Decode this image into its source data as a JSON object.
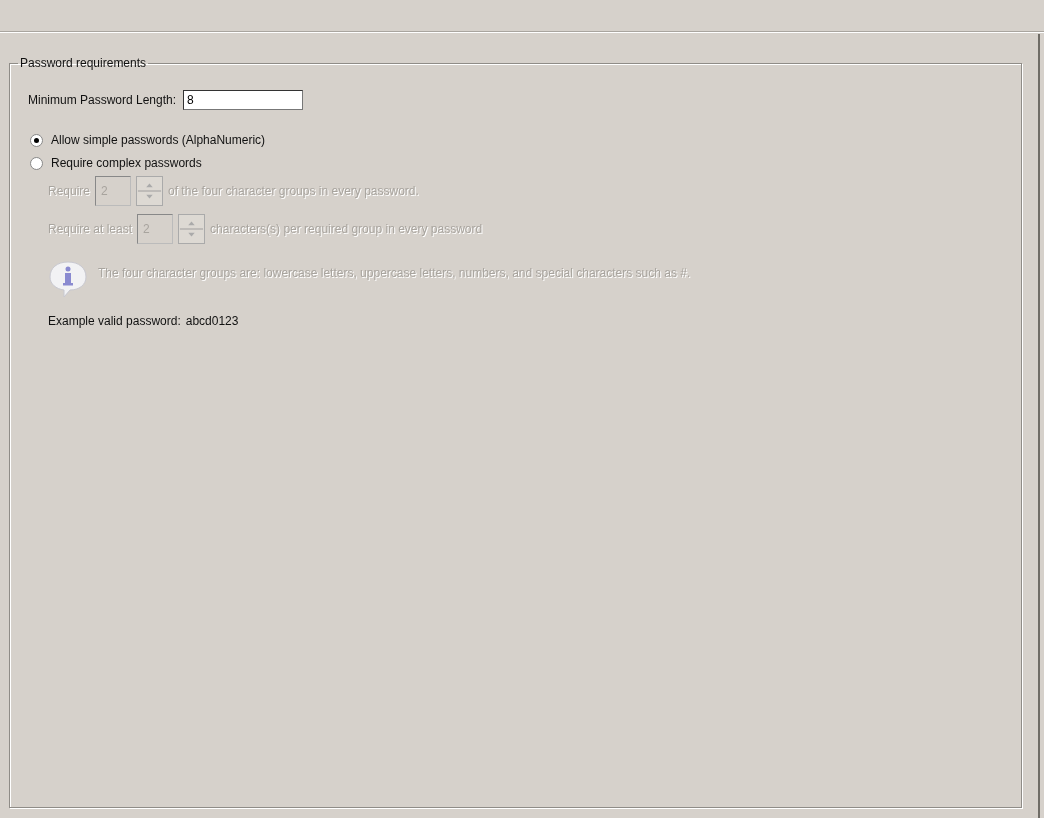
{
  "group": {
    "title": "Password requirements",
    "min_length": {
      "label": "Minimum Password Length:",
      "value": "8"
    },
    "options": [
      {
        "label": "Allow simple passwords (AlphaNumeric)",
        "selected": true
      },
      {
        "label": "Require complex passwords",
        "selected": false
      }
    ],
    "complex": {
      "disabled": true,
      "rows": [
        {
          "before": "Require",
          "value": "2",
          "after": "of the four character groups in every password."
        },
        {
          "before": "Require at least",
          "value": "2",
          "after": "characters(s) per required group in every password"
        }
      ],
      "info": "The four character groups are: lowercase letters, uppercase letters, numbers, and special characters such as #."
    },
    "example": {
      "label": "Example valid password:",
      "value": "abcd0123"
    }
  }
}
